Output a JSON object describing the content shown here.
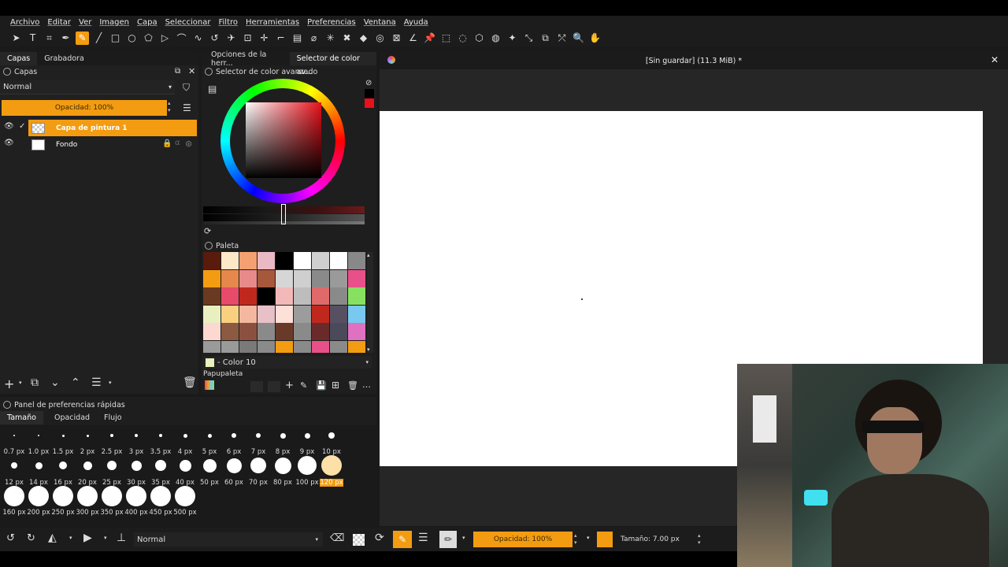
{
  "menu": [
    "Archivo",
    "Editar",
    "Ver",
    "Imagen",
    "Capa",
    "Seleccionar",
    "Filtro",
    "Herramientas",
    "Preferencias",
    "Ventana",
    "Ayuda"
  ],
  "left_tabs": [
    "Capas",
    "Grabadora"
  ],
  "layers_panel": {
    "title": "Capas",
    "blend_mode": "Normal",
    "opacity_label": "Opacidad:  100%",
    "layers": [
      {
        "name": "Capa de pintura 1",
        "selected": true
      },
      {
        "name": "Fondo",
        "selected": false
      }
    ]
  },
  "mid_tabs": [
    "Opciones de la herr...",
    "Selector de color av..."
  ],
  "color_selector": {
    "title": "Selector de color avanzado"
  },
  "palette": {
    "title": "Paleta",
    "current_color": "- Color 10",
    "palette_name": "Papupaleta",
    "colors": [
      "#5a1a0c",
      "#fde8c8",
      "#f4a070",
      "#e9b9c4",
      "#000000",
      "#ffffff",
      "#cfcfcf",
      "#ffffff",
      "#888888",
      "#f39c12",
      "#e6874c",
      "#e88a8a",
      "#a6583c",
      "#d6d6d6",
      "#cfcfcf",
      "#8a8a8a",
      "#9a9a9a",
      "#e8508a",
      "#6a3a20",
      "#e84a6a",
      "#c0281e",
      "#000000",
      "#f3b8b8",
      "#bdbdbd",
      "#e06a6a",
      "#8a8a8a",
      "#88e060",
      "#e8f0c0",
      "#f9d080",
      "#f4b8a0",
      "#e8c0c8",
      "#fde0d8",
      "#9c9c9c",
      "#c0281e",
      "#565062",
      "#78c8f0",
      "#fdd8d0",
      "#8c5a40",
      "#8c5040",
      "#8a8a8a",
      "#6a3a28",
      "#8a8a8a",
      "#6a2a2a",
      "#4a4a5a",
      "#e070c0",
      "#9a9a9a",
      "#9a9a9a",
      "#7a7a7a",
      "#8a8a8a",
      "#f39c12",
      "#8a8a8a",
      "#e8508a",
      "#8a8a8a",
      "#f39c12"
    ]
  },
  "quick_prefs": {
    "title": "Panel de preferencias rápidas",
    "tabs": [
      "Tamaño",
      "Opacidad",
      "Flujo"
    ],
    "sizes_row1": [
      "0.7 px",
      "1.0 px",
      "1.5 px",
      "2 px",
      "2.5 px",
      "3 px",
      "3.5 px",
      "4 px",
      "5 px",
      "6 px",
      "7 px",
      "8 px",
      "9 px",
      "10 px"
    ],
    "sizes_row2": [
      "12 px",
      "14 px",
      "16 px",
      "20 px",
      "25 px",
      "30 px",
      "35 px",
      "40 px",
      "50 px",
      "60 px",
      "70 px",
      "80 px",
      "100 px",
      "120 px"
    ],
    "sizes_row3": [
      "160 px",
      "200 px",
      "250 px",
      "300 px",
      "350 px",
      "400 px",
      "450 px",
      "500 px"
    ],
    "selected_size": "120 px"
  },
  "document": {
    "title": "[Sin guardar]  (11.3 MiB) *"
  },
  "bottom_bar": {
    "blend_mode": "Normal",
    "opacity_label": "Opacidad: 100%",
    "size_label": "Tamaño: 7.00 px"
  },
  "colors": {
    "accent": "#f39c12",
    "foreground": "#e8101a"
  }
}
